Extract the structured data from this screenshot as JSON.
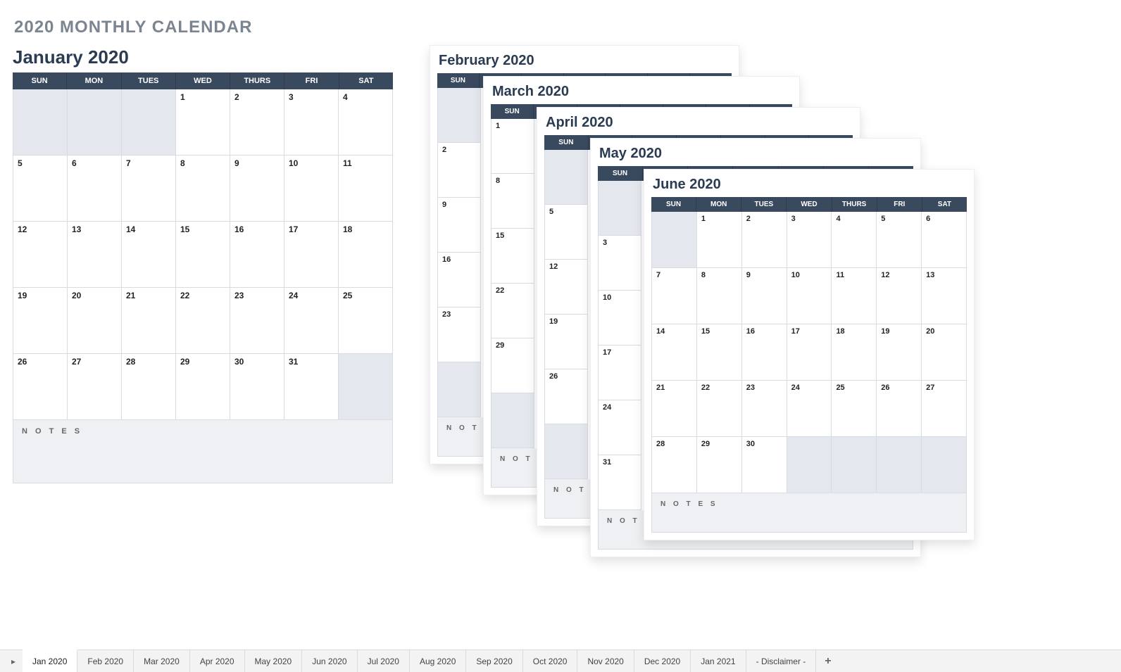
{
  "page_title": "2020 MONTHLY CALENDAR",
  "day_headers": [
    "SUN",
    "MON",
    "TUES",
    "WED",
    "THURS",
    "FRI",
    "SAT"
  ],
  "notes_label": "N O T E S",
  "main": {
    "title": "January 2020",
    "weeks": [
      [
        "",
        "",
        "",
        "1",
        "2",
        "3",
        "4"
      ],
      [
        "5",
        "6",
        "7",
        "8",
        "9",
        "10",
        "11"
      ],
      [
        "12",
        "13",
        "14",
        "15",
        "16",
        "17",
        "18"
      ],
      [
        "19",
        "20",
        "21",
        "22",
        "23",
        "24",
        "25"
      ],
      [
        "26",
        "27",
        "28",
        "29",
        "30",
        "31",
        ""
      ]
    ],
    "pads_before": 3,
    "pads_after": 1
  },
  "stack": {
    "feb": {
      "title": "February 2020",
      "sun_col": [
        "",
        "2",
        "9",
        "16",
        "23",
        ""
      ]
    },
    "mar": {
      "title": "March 2020",
      "sun_col": [
        "1",
        "8",
        "15",
        "22",
        "29",
        ""
      ]
    },
    "apr": {
      "title": "April 2020",
      "sun_col": [
        "",
        "5",
        "12",
        "19",
        "26",
        ""
      ]
    },
    "may": {
      "title": "May 2020",
      "sun_col": [
        "",
        "3",
        "10",
        "17",
        "24",
        "31"
      ]
    },
    "jun": {
      "title": "June 2020",
      "weeks": [
        [
          "",
          "1",
          "2",
          "3",
          "4",
          "5",
          "6"
        ],
        [
          "7",
          "8",
          "9",
          "10",
          "11",
          "12",
          "13"
        ],
        [
          "14",
          "15",
          "16",
          "17",
          "18",
          "19",
          "20"
        ],
        [
          "21",
          "22",
          "23",
          "24",
          "25",
          "26",
          "27"
        ],
        [
          "28",
          "29",
          "30",
          "",
          "",
          "",
          ""
        ]
      ],
      "pads_before": 1,
      "pads_after": 4
    }
  },
  "tabs": [
    "Jan 2020",
    "Feb 2020",
    "Mar 2020",
    "Apr 2020",
    "May 2020",
    "Jun 2020",
    "Jul 2020",
    "Aug 2020",
    "Sep 2020",
    "Oct 2020",
    "Nov 2020",
    "Dec 2020",
    "Jan 2021",
    "- Disclaimer -"
  ],
  "active_tab": 0
}
